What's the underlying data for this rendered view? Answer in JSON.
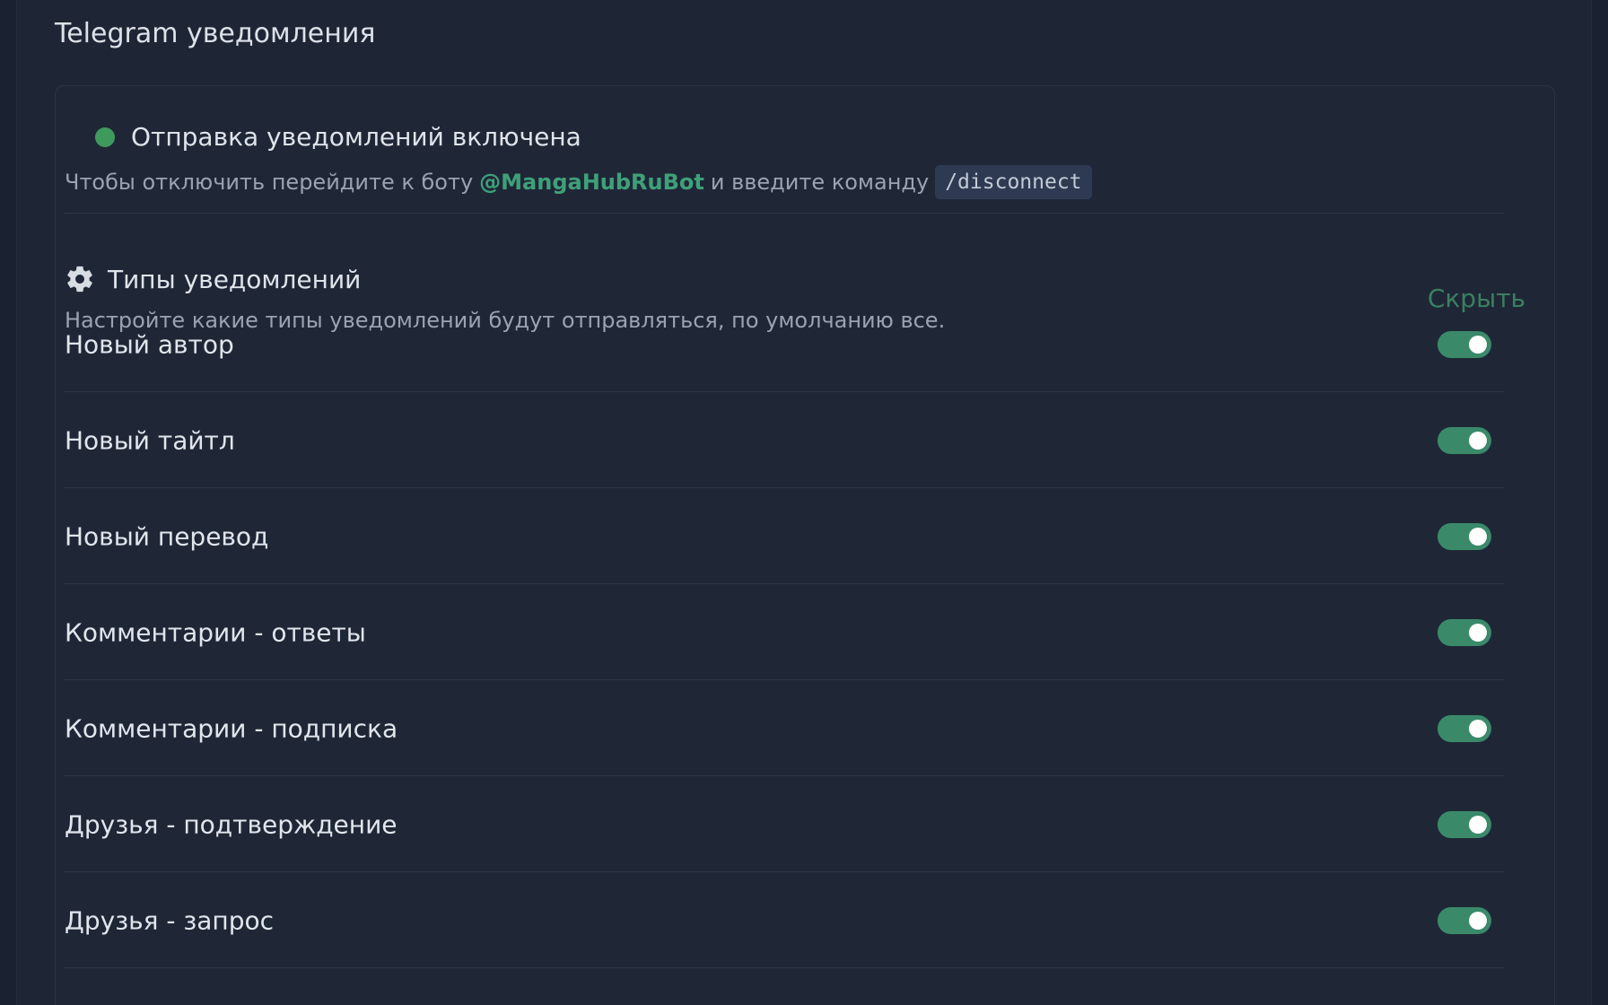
{
  "section": {
    "title": "Telegram уведомления"
  },
  "status": {
    "text": "Отправка уведомлений включена",
    "color": "#3e9a5c"
  },
  "instructions": {
    "prefix": "Чтобы отключить перейдите к боту",
    "bot": "@MangaHubRuBot",
    "middle": "и введите команду",
    "command": "/disconnect"
  },
  "types": {
    "icon": "gear-icon",
    "title": "Типы уведомлений",
    "description": "Настройте какие типы уведомлений будут отправляться, по умолчанию все.",
    "hide_label": "Скрыть"
  },
  "notifications": [
    {
      "label": "Новый автор",
      "enabled": true
    },
    {
      "label": "Новый тайтл",
      "enabled": true
    },
    {
      "label": "Новый перевод",
      "enabled": true
    },
    {
      "label": "Комментарии - ответы",
      "enabled": true
    },
    {
      "label": "Комментарии - подписка",
      "enabled": true
    },
    {
      "label": "Друзья - подтверждение",
      "enabled": true
    },
    {
      "label": "Друзья - запрос",
      "enabled": true
    }
  ],
  "colors": {
    "accent": "#3fa07a",
    "toggle_on": "#3a8a6a",
    "background": "#1e2636"
  }
}
